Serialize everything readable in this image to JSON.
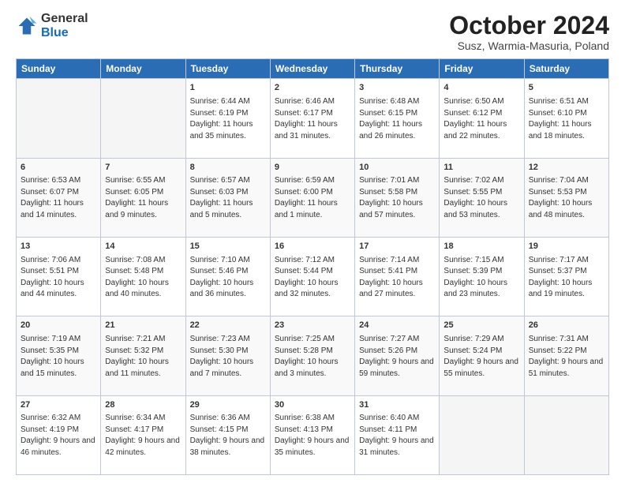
{
  "logo": {
    "general": "General",
    "blue": "Blue"
  },
  "header": {
    "month": "October 2024",
    "location": "Susz, Warmia-Masuria, Poland"
  },
  "weekdays": [
    "Sunday",
    "Monday",
    "Tuesday",
    "Wednesday",
    "Thursday",
    "Friday",
    "Saturday"
  ],
  "weeks": [
    [
      {
        "day": "",
        "sunrise": "",
        "sunset": "",
        "daylight": "",
        "empty": true
      },
      {
        "day": "",
        "sunrise": "",
        "sunset": "",
        "daylight": "",
        "empty": true
      },
      {
        "day": "1",
        "sunrise": "Sunrise: 6:44 AM",
        "sunset": "Sunset: 6:19 PM",
        "daylight": "Daylight: 11 hours and 35 minutes."
      },
      {
        "day": "2",
        "sunrise": "Sunrise: 6:46 AM",
        "sunset": "Sunset: 6:17 PM",
        "daylight": "Daylight: 11 hours and 31 minutes."
      },
      {
        "day": "3",
        "sunrise": "Sunrise: 6:48 AM",
        "sunset": "Sunset: 6:15 PM",
        "daylight": "Daylight: 11 hours and 26 minutes."
      },
      {
        "day": "4",
        "sunrise": "Sunrise: 6:50 AM",
        "sunset": "Sunset: 6:12 PM",
        "daylight": "Daylight: 11 hours and 22 minutes."
      },
      {
        "day": "5",
        "sunrise": "Sunrise: 6:51 AM",
        "sunset": "Sunset: 6:10 PM",
        "daylight": "Daylight: 11 hours and 18 minutes."
      }
    ],
    [
      {
        "day": "6",
        "sunrise": "Sunrise: 6:53 AM",
        "sunset": "Sunset: 6:07 PM",
        "daylight": "Daylight: 11 hours and 14 minutes."
      },
      {
        "day": "7",
        "sunrise": "Sunrise: 6:55 AM",
        "sunset": "Sunset: 6:05 PM",
        "daylight": "Daylight: 11 hours and 9 minutes."
      },
      {
        "day": "8",
        "sunrise": "Sunrise: 6:57 AM",
        "sunset": "Sunset: 6:03 PM",
        "daylight": "Daylight: 11 hours and 5 minutes."
      },
      {
        "day": "9",
        "sunrise": "Sunrise: 6:59 AM",
        "sunset": "Sunset: 6:00 PM",
        "daylight": "Daylight: 11 hours and 1 minute."
      },
      {
        "day": "10",
        "sunrise": "Sunrise: 7:01 AM",
        "sunset": "Sunset: 5:58 PM",
        "daylight": "Daylight: 10 hours and 57 minutes."
      },
      {
        "day": "11",
        "sunrise": "Sunrise: 7:02 AM",
        "sunset": "Sunset: 5:55 PM",
        "daylight": "Daylight: 10 hours and 53 minutes."
      },
      {
        "day": "12",
        "sunrise": "Sunrise: 7:04 AM",
        "sunset": "Sunset: 5:53 PM",
        "daylight": "Daylight: 10 hours and 48 minutes."
      }
    ],
    [
      {
        "day": "13",
        "sunrise": "Sunrise: 7:06 AM",
        "sunset": "Sunset: 5:51 PM",
        "daylight": "Daylight: 10 hours and 44 minutes."
      },
      {
        "day": "14",
        "sunrise": "Sunrise: 7:08 AM",
        "sunset": "Sunset: 5:48 PM",
        "daylight": "Daylight: 10 hours and 40 minutes."
      },
      {
        "day": "15",
        "sunrise": "Sunrise: 7:10 AM",
        "sunset": "Sunset: 5:46 PM",
        "daylight": "Daylight: 10 hours and 36 minutes."
      },
      {
        "day": "16",
        "sunrise": "Sunrise: 7:12 AM",
        "sunset": "Sunset: 5:44 PM",
        "daylight": "Daylight: 10 hours and 32 minutes."
      },
      {
        "day": "17",
        "sunrise": "Sunrise: 7:14 AM",
        "sunset": "Sunset: 5:41 PM",
        "daylight": "Daylight: 10 hours and 27 minutes."
      },
      {
        "day": "18",
        "sunrise": "Sunrise: 7:15 AM",
        "sunset": "Sunset: 5:39 PM",
        "daylight": "Daylight: 10 hours and 23 minutes."
      },
      {
        "day": "19",
        "sunrise": "Sunrise: 7:17 AM",
        "sunset": "Sunset: 5:37 PM",
        "daylight": "Daylight: 10 hours and 19 minutes."
      }
    ],
    [
      {
        "day": "20",
        "sunrise": "Sunrise: 7:19 AM",
        "sunset": "Sunset: 5:35 PM",
        "daylight": "Daylight: 10 hours and 15 minutes."
      },
      {
        "day": "21",
        "sunrise": "Sunrise: 7:21 AM",
        "sunset": "Sunset: 5:32 PM",
        "daylight": "Daylight: 10 hours and 11 minutes."
      },
      {
        "day": "22",
        "sunrise": "Sunrise: 7:23 AM",
        "sunset": "Sunset: 5:30 PM",
        "daylight": "Daylight: 10 hours and 7 minutes."
      },
      {
        "day": "23",
        "sunrise": "Sunrise: 7:25 AM",
        "sunset": "Sunset: 5:28 PM",
        "daylight": "Daylight: 10 hours and 3 minutes."
      },
      {
        "day": "24",
        "sunrise": "Sunrise: 7:27 AM",
        "sunset": "Sunset: 5:26 PM",
        "daylight": "Daylight: 9 hours and 59 minutes."
      },
      {
        "day": "25",
        "sunrise": "Sunrise: 7:29 AM",
        "sunset": "Sunset: 5:24 PM",
        "daylight": "Daylight: 9 hours and 55 minutes."
      },
      {
        "day": "26",
        "sunrise": "Sunrise: 7:31 AM",
        "sunset": "Sunset: 5:22 PM",
        "daylight": "Daylight: 9 hours and 51 minutes."
      }
    ],
    [
      {
        "day": "27",
        "sunrise": "Sunrise: 6:32 AM",
        "sunset": "Sunset: 4:19 PM",
        "daylight": "Daylight: 9 hours and 46 minutes."
      },
      {
        "day": "28",
        "sunrise": "Sunrise: 6:34 AM",
        "sunset": "Sunset: 4:17 PM",
        "daylight": "Daylight: 9 hours and 42 minutes."
      },
      {
        "day": "29",
        "sunrise": "Sunrise: 6:36 AM",
        "sunset": "Sunset: 4:15 PM",
        "daylight": "Daylight: 9 hours and 38 minutes."
      },
      {
        "day": "30",
        "sunrise": "Sunrise: 6:38 AM",
        "sunset": "Sunset: 4:13 PM",
        "daylight": "Daylight: 9 hours and 35 minutes."
      },
      {
        "day": "31",
        "sunrise": "Sunrise: 6:40 AM",
        "sunset": "Sunset: 4:11 PM",
        "daylight": "Daylight: 9 hours and 31 minutes."
      },
      {
        "day": "",
        "sunrise": "",
        "sunset": "",
        "daylight": "",
        "empty": true
      },
      {
        "day": "",
        "sunrise": "",
        "sunset": "",
        "daylight": "",
        "empty": true
      }
    ]
  ]
}
